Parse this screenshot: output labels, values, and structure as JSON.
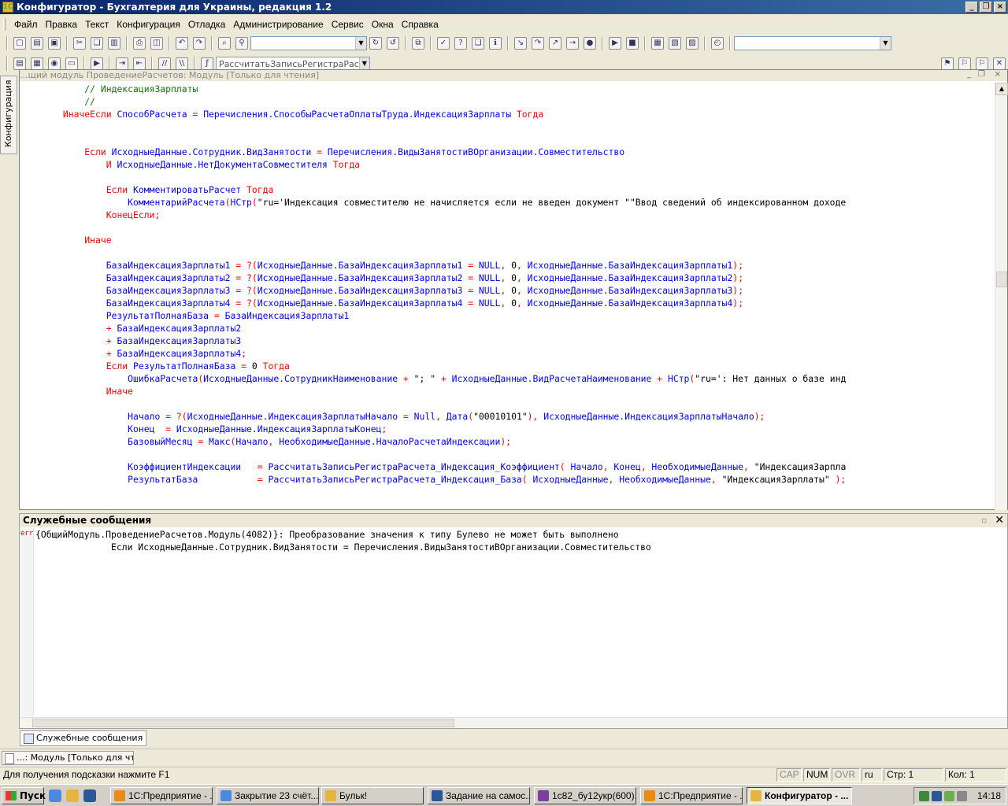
{
  "window": {
    "title": "Конфигуратор - Бухгалтерия для Украины, редакция 1.2"
  },
  "menu": [
    "Файл",
    "Правка",
    "Текст",
    "Конфигурация",
    "Отладка",
    "Администрирование",
    "Сервис",
    "Окна",
    "Справка"
  ],
  "toolbar2": {
    "procedure_combo": "РассчитатьЗаписьРегистраРас"
  },
  "left_tab": {
    "label": "Конфигурация"
  },
  "editor": {
    "caption": "...щий модуль ПроведениеРасчетов: Модуль [Только для чтения]",
    "lines": [
      [
        {
          "t": "c",
          "v": "            // ИндексацияЗарплаты"
        }
      ],
      [
        {
          "t": "c",
          "v": "            //"
        }
      ],
      [
        {
          "t": "k",
          "v": "        ИначеЕсли "
        },
        {
          "t": "i",
          "v": "СпособРасчета "
        },
        {
          "t": "k",
          "v": "= "
        },
        {
          "t": "i",
          "v": "Перечисления.СпособыРасчетаОплатыТруда.ИндексацияЗарплаты "
        },
        {
          "t": "k",
          "v": "Тогда"
        }
      ],
      [],
      [],
      [
        {
          "t": "k",
          "v": "            Если "
        },
        {
          "t": "i",
          "v": "ИсходныеДанные.Сотрудник.ВидЗанятости "
        },
        {
          "t": "k",
          "v": "= "
        },
        {
          "t": "i",
          "v": "Перечисления.ВидыЗанятостиВОрганизации.Совместительство"
        }
      ],
      [
        {
          "t": "k",
          "v": "                И "
        },
        {
          "t": "i",
          "v": "ИсходныеДанные.НетДокументаСовместителя "
        },
        {
          "t": "k",
          "v": "Тогда"
        }
      ],
      [],
      [
        {
          "t": "k",
          "v": "                Если "
        },
        {
          "t": "i",
          "v": "КомментироватьРасчет "
        },
        {
          "t": "k",
          "v": "Тогда"
        }
      ],
      [
        {
          "t": "i",
          "v": "                    КомментарийРасчета"
        },
        {
          "t": "k",
          "v": "("
        },
        {
          "t": "i",
          "v": "НСтр"
        },
        {
          "t": "k",
          "v": "("
        },
        {
          "t": "s",
          "v": "\"ru='Индексация совместителю не начисляется если не введен документ \"\"Ввод сведений об индексированном доходе"
        }
      ],
      [
        {
          "t": "k",
          "v": "                КонецЕсли;"
        }
      ],
      [],
      [
        {
          "t": "k",
          "v": "            Иначе"
        }
      ],
      [],
      [
        {
          "t": "i",
          "v": "                БазаИндексацияЗарплаты1 "
        },
        {
          "t": "k",
          "v": "= ?("
        },
        {
          "t": "i",
          "v": "ИсходныеДанные.БазаИндексацияЗарплаты1 "
        },
        {
          "t": "k",
          "v": "= "
        },
        {
          "t": "i",
          "v": "NULL"
        },
        {
          "t": "k",
          "v": ", "
        },
        {
          "t": "s",
          "v": "0"
        },
        {
          "t": "k",
          "v": ", "
        },
        {
          "t": "i",
          "v": "ИсходныеДанные.БазаИндексацияЗарплаты1"
        },
        {
          "t": "k",
          "v": ");"
        }
      ],
      [
        {
          "t": "i",
          "v": "                БазаИндексацияЗарплаты2 "
        },
        {
          "t": "k",
          "v": "= ?("
        },
        {
          "t": "i",
          "v": "ИсходныеДанные.БазаИндексацияЗарплаты2 "
        },
        {
          "t": "k",
          "v": "= "
        },
        {
          "t": "i",
          "v": "NULL"
        },
        {
          "t": "k",
          "v": ", "
        },
        {
          "t": "s",
          "v": "0"
        },
        {
          "t": "k",
          "v": ", "
        },
        {
          "t": "i",
          "v": "ИсходныеДанные.БазаИндексацияЗарплаты2"
        },
        {
          "t": "k",
          "v": ");"
        }
      ],
      [
        {
          "t": "i",
          "v": "                БазаИндексацияЗарплаты3 "
        },
        {
          "t": "k",
          "v": "= ?("
        },
        {
          "t": "i",
          "v": "ИсходныеДанные.БазаИндексацияЗарплаты3 "
        },
        {
          "t": "k",
          "v": "= "
        },
        {
          "t": "i",
          "v": "NULL"
        },
        {
          "t": "k",
          "v": ", "
        },
        {
          "t": "s",
          "v": "0"
        },
        {
          "t": "k",
          "v": ", "
        },
        {
          "t": "i",
          "v": "ИсходныеДанные.БазаИндексацияЗарплаты3"
        },
        {
          "t": "k",
          "v": ");"
        }
      ],
      [
        {
          "t": "i",
          "v": "                БазаИндексацияЗарплаты4 "
        },
        {
          "t": "k",
          "v": "= ?("
        },
        {
          "t": "i",
          "v": "ИсходныеДанные.БазаИндексацияЗарплаты4 "
        },
        {
          "t": "k",
          "v": "= "
        },
        {
          "t": "i",
          "v": "NULL"
        },
        {
          "t": "k",
          "v": ", "
        },
        {
          "t": "s",
          "v": "0"
        },
        {
          "t": "k",
          "v": ", "
        },
        {
          "t": "i",
          "v": "ИсходныеДанные.БазаИндексацияЗарплаты4"
        },
        {
          "t": "k",
          "v": ");"
        }
      ],
      [
        {
          "t": "i",
          "v": "                РезультатПолнаяБаза "
        },
        {
          "t": "k",
          "v": "= "
        },
        {
          "t": "i",
          "v": "БазаИндексацияЗарплаты1"
        }
      ],
      [
        {
          "t": "k",
          "v": "                + "
        },
        {
          "t": "i",
          "v": "БазаИндексацияЗарплаты2"
        }
      ],
      [
        {
          "t": "k",
          "v": "                + "
        },
        {
          "t": "i",
          "v": "БазаИндексацияЗарплаты3"
        }
      ],
      [
        {
          "t": "k",
          "v": "                + "
        },
        {
          "t": "i",
          "v": "БазаИндексацияЗарплаты4"
        },
        {
          "t": "k",
          "v": ";"
        }
      ],
      [
        {
          "t": "k",
          "v": "                Если "
        },
        {
          "t": "i",
          "v": "РезультатПолнаяБаза "
        },
        {
          "t": "k",
          "v": "= "
        },
        {
          "t": "s",
          "v": "0 "
        },
        {
          "t": "k",
          "v": "Тогда"
        }
      ],
      [
        {
          "t": "i",
          "v": "                    ОшибкаРасчета"
        },
        {
          "t": "k",
          "v": "("
        },
        {
          "t": "i",
          "v": "ИсходныеДанные.СотрудникНаименование "
        },
        {
          "t": "k",
          "v": "+ "
        },
        {
          "t": "s",
          "v": "\"; \" "
        },
        {
          "t": "k",
          "v": "+ "
        },
        {
          "t": "i",
          "v": "ИсходныеДанные.ВидРасчетаНаименование "
        },
        {
          "t": "k",
          "v": "+ "
        },
        {
          "t": "i",
          "v": "НСтр"
        },
        {
          "t": "k",
          "v": "("
        },
        {
          "t": "s",
          "v": "\"ru=': Нет данных о базе инд"
        }
      ],
      [
        {
          "t": "k",
          "v": "                Иначе"
        }
      ],
      [],
      [
        {
          "t": "i",
          "v": "                    Начало "
        },
        {
          "t": "k",
          "v": "= ?("
        },
        {
          "t": "i",
          "v": "ИсходныеДанные.ИндексацияЗарплатыНачало "
        },
        {
          "t": "k",
          "v": "= "
        },
        {
          "t": "i",
          "v": "Null"
        },
        {
          "t": "k",
          "v": ", "
        },
        {
          "t": "i",
          "v": "Дата"
        },
        {
          "t": "k",
          "v": "("
        },
        {
          "t": "s",
          "v": "\"00010101\""
        },
        {
          "t": "k",
          "v": "), "
        },
        {
          "t": "i",
          "v": "ИсходныеДанные.ИндексацияЗарплатыНачало"
        },
        {
          "t": "k",
          "v": ");"
        }
      ],
      [
        {
          "t": "i",
          "v": "                    Конец  "
        },
        {
          "t": "k",
          "v": "= "
        },
        {
          "t": "i",
          "v": "ИсходныеДанные.ИндексацияЗарплатыКонец"
        },
        {
          "t": "k",
          "v": ";"
        }
      ],
      [
        {
          "t": "i",
          "v": "                    БазовыйМесяц "
        },
        {
          "t": "k",
          "v": "= "
        },
        {
          "t": "i",
          "v": "Макс"
        },
        {
          "t": "k",
          "v": "("
        },
        {
          "t": "i",
          "v": "Начало"
        },
        {
          "t": "k",
          "v": ", "
        },
        {
          "t": "i",
          "v": "НеобходимыеДанные.НачалоРасчетаИндексации"
        },
        {
          "t": "k",
          "v": ");"
        }
      ],
      [],
      [
        {
          "t": "i",
          "v": "                    КоэффициентИндексации   "
        },
        {
          "t": "k",
          "v": "= "
        },
        {
          "t": "i",
          "v": "РассчитатьЗаписьРегистраРасчета_Индексация_Коэффициент"
        },
        {
          "t": "k",
          "v": "( "
        },
        {
          "t": "i",
          "v": "Начало"
        },
        {
          "t": "k",
          "v": ", "
        },
        {
          "t": "i",
          "v": "Конец"
        },
        {
          "t": "k",
          "v": ", "
        },
        {
          "t": "i",
          "v": "НеобходимыеДанные"
        },
        {
          "t": "k",
          "v": ", "
        },
        {
          "t": "s",
          "v": "\"ИндексацияЗарпла"
        }
      ],
      [
        {
          "t": "i",
          "v": "                    РезультатБаза           "
        },
        {
          "t": "k",
          "v": "= "
        },
        {
          "t": "i",
          "v": "РассчитатьЗаписьРегистраРасчета_Индексация_База"
        },
        {
          "t": "k",
          "v": "( "
        },
        {
          "t": "i",
          "v": "ИсходныеДанные"
        },
        {
          "t": "k",
          "v": ", "
        },
        {
          "t": "i",
          "v": "НеобходимыеДанные"
        },
        {
          "t": "k",
          "v": ", "
        },
        {
          "t": "s",
          "v": "\"ИндексацияЗарплаты\" "
        },
        {
          "t": "k",
          "v": ");"
        }
      ]
    ]
  },
  "messages": {
    "title": "Служебные сообщения",
    "err_tag": "err",
    "line1": "{ОбщийМодуль.ПроведениеРасчетов.Модуль(4082)}: Преобразование значения к типу Булево не может быть выполнено",
    "line2": "              Если ИсходныеДанные.Сотрудник.ВидЗанятости = Перечисления.ВидыЗанятостиВОрганизации.Совместительство"
  },
  "panel_tab": "Служебные сообщения",
  "window_button": "...: Модуль [Только для чте...",
  "status": {
    "hint": "Для получения подсказки нажмите F1",
    "cap": "CAP",
    "num": "NUM",
    "ovr": "OVR",
    "lang": "ru",
    "line": "Стр: 1",
    "col": "Кол: 1"
  },
  "taskbar": {
    "start": "Пуск",
    "tasks": [
      {
        "label": "1С:Предприятие - ...",
        "color": "#e88a1a"
      },
      {
        "label": "Закрытие 23 счёт...",
        "color": "#4a8be0"
      },
      {
        "label": "Бульк!",
        "color": "#e7b53f"
      },
      {
        "label": "Задание на самос...",
        "color": "#2b5797"
      },
      {
        "label": "1с82_бу12укр(600)...",
        "color": "#7a3fa0"
      },
      {
        "label": "1С:Предприятие - ...",
        "color": "#e88a1a"
      },
      {
        "label": "Конфигуратор - ...",
        "color": "#e7b53f"
      }
    ],
    "clock": "14:18"
  }
}
